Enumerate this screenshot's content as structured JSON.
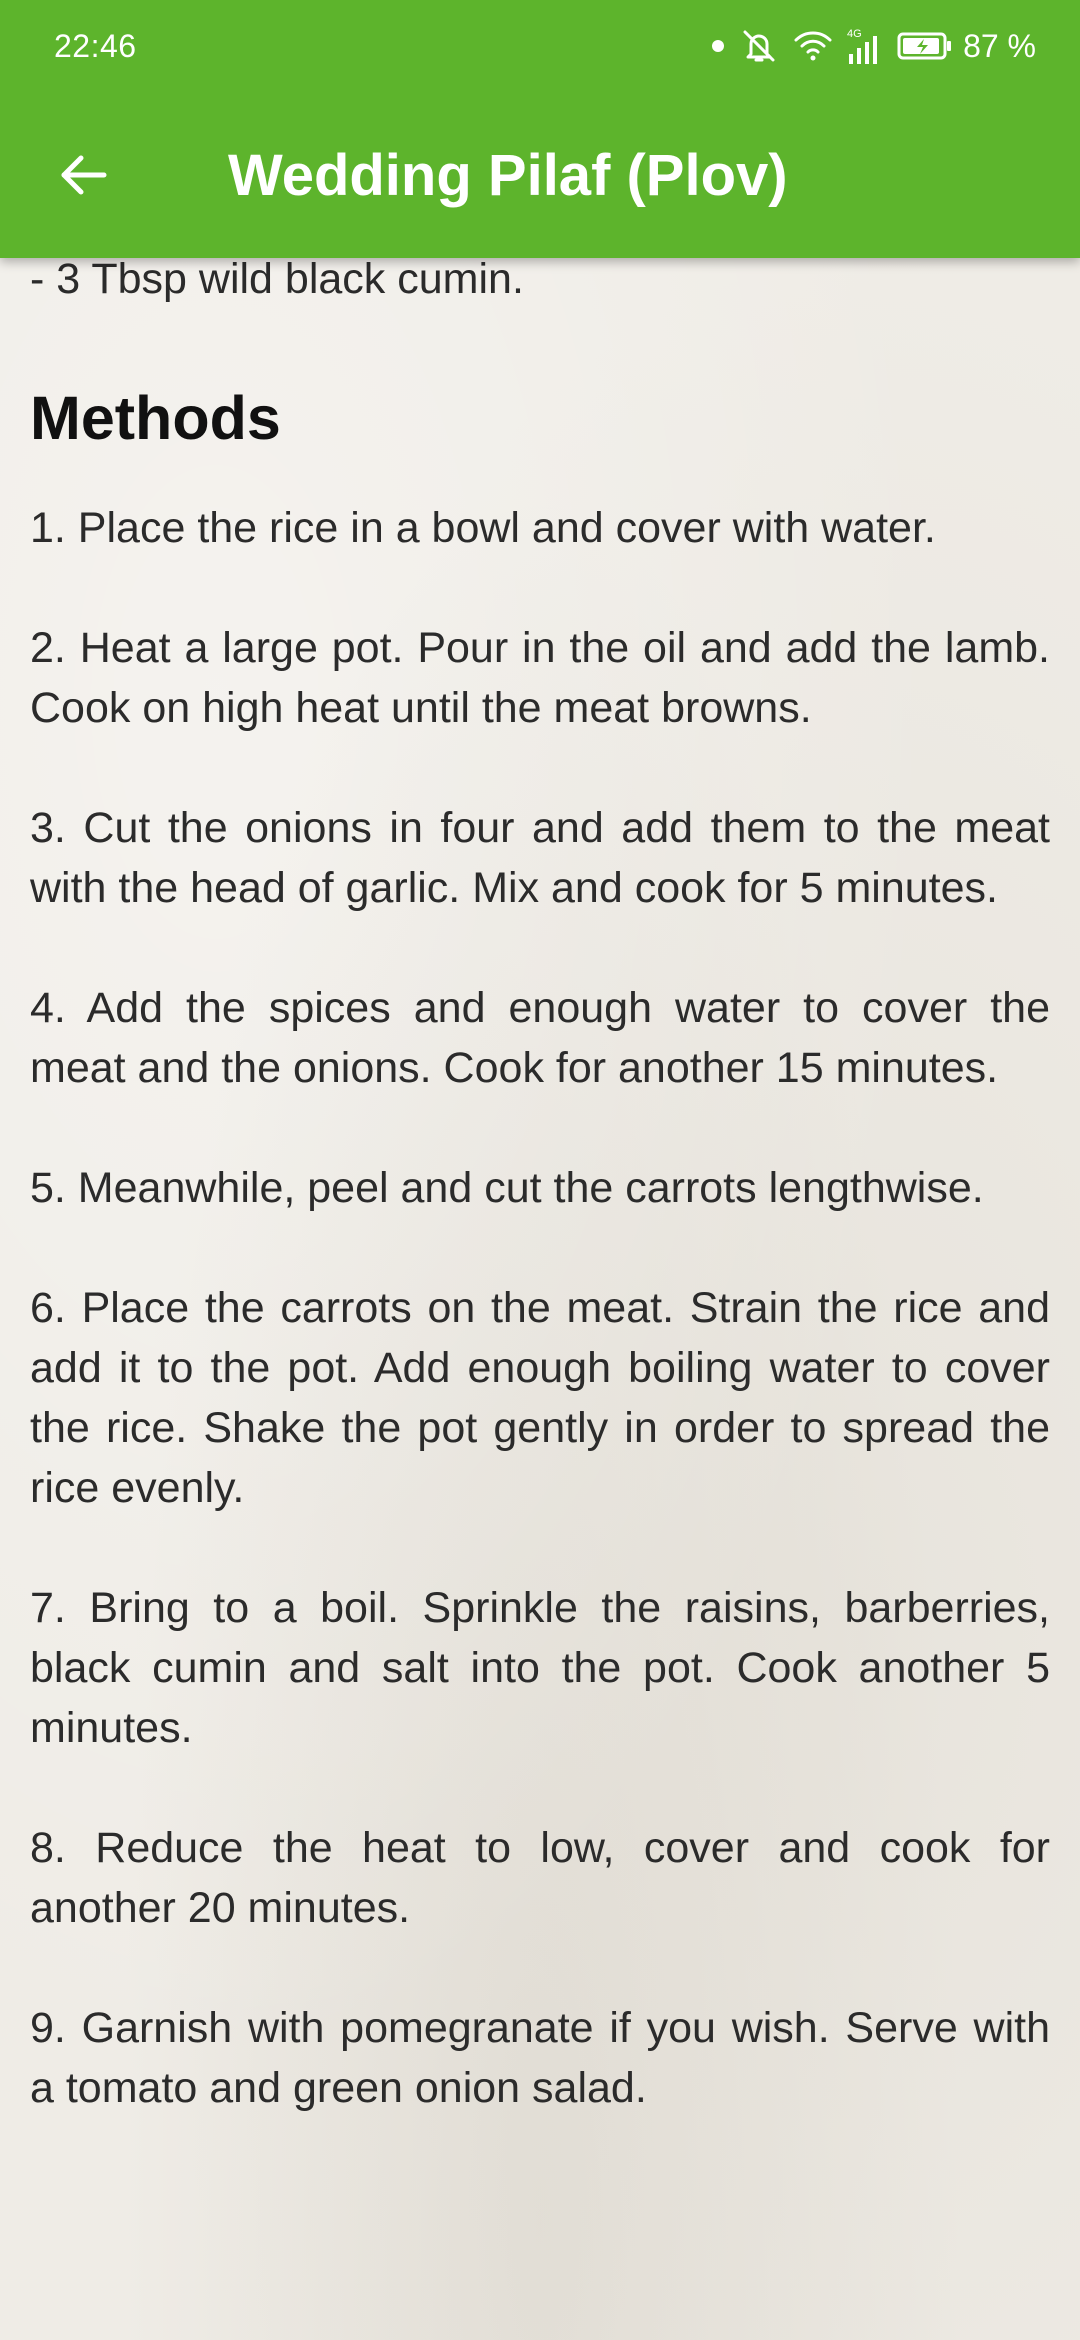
{
  "status_bar": {
    "time": "22:46",
    "battery_percent": "87 %",
    "network_label": "4G",
    "icons": [
      "notification-dot-icon",
      "mute-icon",
      "wifi-icon",
      "cell-signal-icon",
      "battery-charging-icon"
    ]
  },
  "toolbar": {
    "title": "Wedding Pilaf (Plov)",
    "back_icon": "arrow-back-icon"
  },
  "content": {
    "ingredient_tail": "- 3 Tbsp wild black cumin.",
    "methods_heading": "Methods",
    "steps": [
      "1. Place the rice in a bowl and cover with water.",
      "2. Heat a large pot. Pour in the oil and add the lamb. Cook on high heat until the meat browns.",
      "3. Cut the onions in four and add them to the meat with the head of garlic. Mix and cook for 5 minutes.",
      "4. Add the spices and enough water to cover the meat and the onions. Cook for another 15 minutes.",
      "5. Meanwhile, peel and cut the carrots lengthwise.",
      "6. Place the carrots on the meat. Strain the rice and add it to the pot. Add enough boiling water to cover the rice. Shake the pot gently in order to spread the rice evenly.",
      "7. Bring to a boil. Sprinkle the raisins, barberries, black cumin and salt into the pot. Cook another 5 minutes.",
      "8. Reduce the heat to low, cover and cook for another 20 minutes.",
      "9. Garnish with pomegranate if you wish. Serve with a tomato and green onion salad."
    ]
  },
  "colors": {
    "app_bar": "#5db42c",
    "background": "#efece6",
    "text": "#2b2b2b",
    "heading": "#111111"
  }
}
